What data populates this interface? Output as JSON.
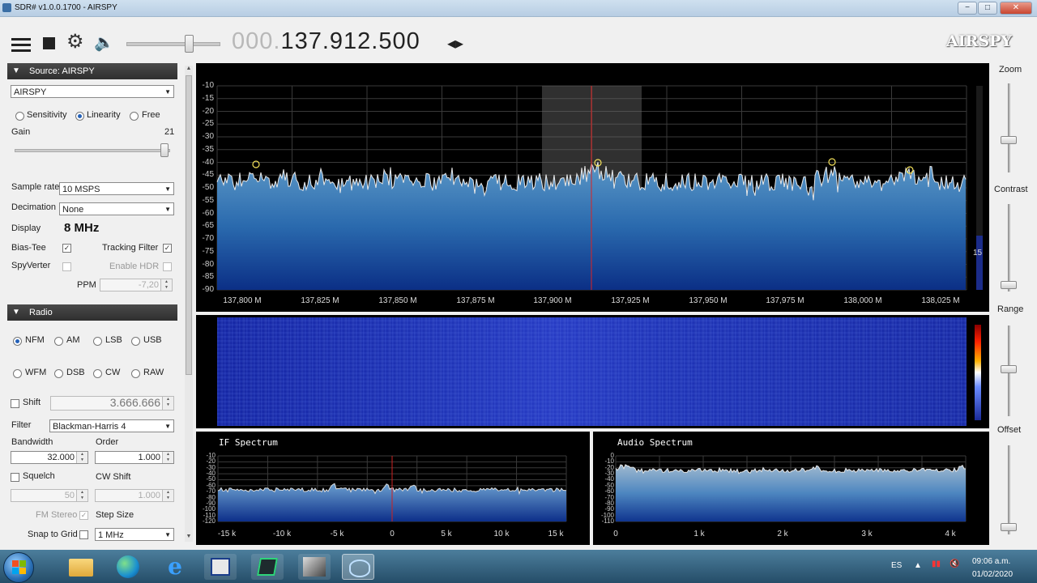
{
  "window": {
    "title": "SDR# v1.0.0.1700 - AIRSPY",
    "min": "−",
    "max": "□",
    "close": "✕"
  },
  "toolbar": {
    "freq_dim": "000.",
    "freq_main": "137.912.500",
    "logo": "AIRSPY",
    "volume": 0.65
  },
  "source": {
    "header": "Source: AIRSPY",
    "device": "AIRSPY",
    "modes": [
      "Sensitivity",
      "Linearity",
      "Free"
    ],
    "mode_selected": "Linearity",
    "gain_label": "Gain",
    "gain_value": "21",
    "sample_rate_label": "Sample rate",
    "sample_rate": "10 MSPS",
    "decimation_label": "Decimation",
    "decimation": "None",
    "display_label": "Display",
    "display_value": "8 MHz",
    "bias_tee_label": "Bias-Tee",
    "tracking_filter_label": "Tracking Filter",
    "spyverter_label": "SpyVerter",
    "enable_hdr_label": "Enable HDR",
    "ppm_label": "PPM",
    "ppm_value": "-7,20"
  },
  "radio": {
    "header": "Radio",
    "modes_row1": [
      "NFM",
      "AM",
      "LSB",
      "USB"
    ],
    "modes_row2": [
      "WFM",
      "DSB",
      "CW",
      "RAW"
    ],
    "mode_selected": "NFM",
    "shift_label": "Shift",
    "shift_value": "3.666.666",
    "filter_label": "Filter",
    "filter_value": "Blackman-Harris 4",
    "bandwidth_label": "Bandwidth",
    "bandwidth_value": "32.000",
    "order_label": "Order",
    "order_value": "1.000",
    "squelch_label": "Squelch",
    "squelch_value": "50",
    "cw_shift_label": "CW Shift",
    "cw_shift_value": "1.000",
    "fm_stereo_label": "FM Stereo",
    "step_size_label": "Step Size",
    "snap_label": "Snap to Grid",
    "step_value": "1 MHz"
  },
  "spectrum": {
    "y_labels": [
      "-10",
      "-15",
      "-20",
      "-25",
      "-30",
      "-35",
      "-40",
      "-45",
      "-50",
      "-55",
      "-60",
      "-65",
      "-70",
      "-75",
      "-80",
      "-85",
      "-90"
    ],
    "x_labels": [
      "137,800 M",
      "137,825 M",
      "137,850 M",
      "137,875 M",
      "137,900 M",
      "137,925 M",
      "137,950 M",
      "137,975 M",
      "138,000 M",
      "138,025 M"
    ],
    "side_value": "15"
  },
  "if_spectrum": {
    "title": "IF Spectrum",
    "y_labels": [
      "-10",
      "-20",
      "-30",
      "-40",
      "-50",
      "-60",
      "-70",
      "-80",
      "-90",
      "-100",
      "-110",
      "-120"
    ],
    "x_labels": [
      "-15 k",
      "-10 k",
      "-5 k",
      "0",
      "5 k",
      "10 k",
      "15 k"
    ]
  },
  "audio_spectrum": {
    "title": "Audio Spectrum",
    "y_labels": [
      "0",
      "-10",
      "-20",
      "-30",
      "-40",
      "-50",
      "-60",
      "-70",
      "-80",
      "-90",
      "-100",
      "-110"
    ],
    "x_labels": [
      "0",
      "1 k",
      "2 k",
      "3 k",
      "4 k"
    ]
  },
  "right_strip": {
    "zoom": "Zoom",
    "contrast": "Contrast",
    "range": "Range",
    "offset": "Offset"
  },
  "taskbar": {
    "lang": "ES",
    "time": "09:06 a.m.",
    "date": "01/02/2020"
  }
}
